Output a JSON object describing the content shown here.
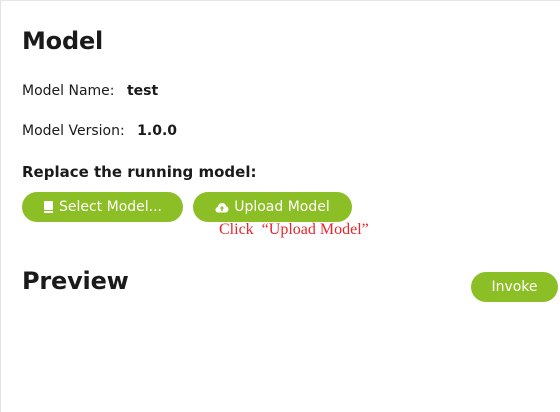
{
  "model_section": {
    "title": "Model",
    "name_label": "Model Name:",
    "name_value": "test",
    "version_label": "Model Version:",
    "version_value": "1.0.0",
    "replace_heading": "Replace the running model:",
    "select_button": {
      "label": "Select Model...",
      "icon": "file-icon"
    },
    "upload_button": {
      "label": "Upload Model",
      "icon": "cloud-upload-icon"
    },
    "annotation": "Click  “Upload Model”"
  },
  "preview_section": {
    "title": "Preview",
    "invoke_label": "Invoke"
  },
  "colors": {
    "accent": "#8cbf26",
    "annotation": "#e8262b"
  }
}
